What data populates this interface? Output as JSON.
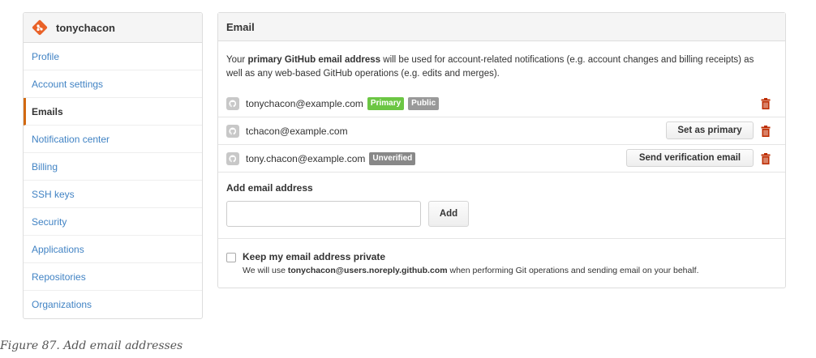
{
  "sidebar": {
    "username": "tonychacon",
    "items": [
      {
        "label": "Profile",
        "active": false
      },
      {
        "label": "Account settings",
        "active": false
      },
      {
        "label": "Emails",
        "active": true
      },
      {
        "label": "Notification center",
        "active": false
      },
      {
        "label": "Billing",
        "active": false
      },
      {
        "label": "SSH keys",
        "active": false
      },
      {
        "label": "Security",
        "active": false
      },
      {
        "label": "Applications",
        "active": false
      },
      {
        "label": "Repositories",
        "active": false
      },
      {
        "label": "Organizations",
        "active": false
      }
    ]
  },
  "panel": {
    "title": "Email",
    "intro_before": "Your ",
    "intro_bold": "primary GitHub email address",
    "intro_after": " will be used for account-related notifications (e.g. account changes and billing receipts) as well as any web-based GitHub operations (e.g. edits and merges).",
    "emails": [
      {
        "address": "tonychacon@example.com",
        "badges": [
          "Primary",
          "Public"
        ],
        "button": ""
      },
      {
        "address": "tchacon@example.com",
        "badges": [],
        "button": "Set as primary"
      },
      {
        "address": "tony.chacon@example.com",
        "badges": [
          "Unverified"
        ],
        "button": "Send verification email"
      }
    ],
    "add_label": "Add email address",
    "add_input_value": "",
    "add_button": "Add",
    "private_label": "Keep my email address private",
    "private_note_before": "We will use ",
    "private_note_bold": "tonychacon@users.noreply.github.com",
    "private_note_after": " when performing Git operations and sending email on your behalf.",
    "private_checked": false
  },
  "caption": "Figure 87. Add email addresses",
  "colors": {
    "link": "#4183c4",
    "active_border": "#d26911",
    "badge_primary": "#6cc644",
    "badge_public": "#999999",
    "badge_unverified": "#888888",
    "trash": "#bd2c00",
    "logo": "#e96228"
  },
  "icons": {
    "logo": "git-logo-icon",
    "avatar": "avatar-icon",
    "delete": "trash-icon"
  }
}
